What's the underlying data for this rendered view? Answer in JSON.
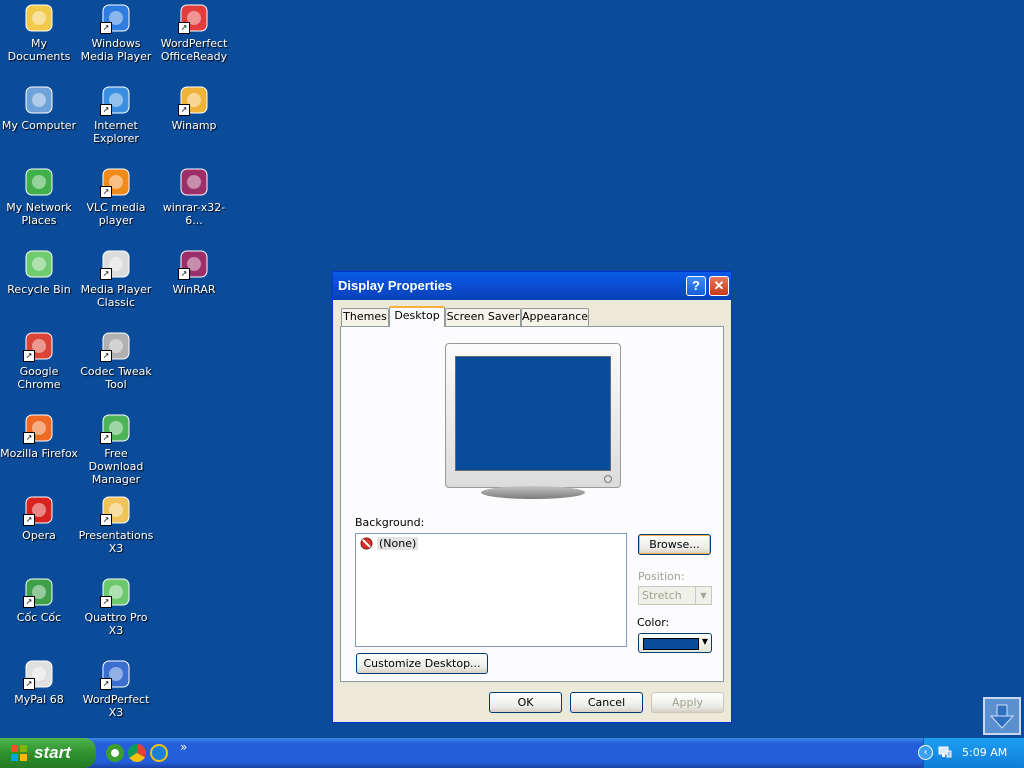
{
  "desktop": {
    "icons": [
      {
        "id": "my-documents",
        "label": "My Documents",
        "icon": "folder-icon",
        "shortcut": false
      },
      {
        "id": "windows-media-player",
        "label": "Windows Media Player",
        "icon": "media-player-icon",
        "shortcut": true
      },
      {
        "id": "wordperfect-officeready",
        "label": "WordPerfect OfficeReady",
        "icon": "officeready-icon",
        "shortcut": true
      },
      {
        "id": "my-computer",
        "label": "My Computer",
        "icon": "computer-icon",
        "shortcut": false
      },
      {
        "id": "internet-explorer",
        "label": "Internet Explorer",
        "icon": "ie-icon",
        "shortcut": true
      },
      {
        "id": "winamp",
        "label": "Winamp",
        "icon": "winamp-icon",
        "shortcut": true
      },
      {
        "id": "my-network-places",
        "label": "My Network Places",
        "icon": "network-icon",
        "shortcut": false
      },
      {
        "id": "vlc",
        "label": "VLC media player",
        "icon": "vlc-icon",
        "shortcut": true
      },
      {
        "id": "winrar-x32",
        "label": "winrar-x32-6...",
        "icon": "winrar-icon",
        "shortcut": false
      },
      {
        "id": "recycle-bin",
        "label": "Recycle Bin",
        "icon": "recycle-bin-icon",
        "shortcut": false
      },
      {
        "id": "mpc",
        "label": "Media Player Classic",
        "icon": "mpc-icon",
        "shortcut": true
      },
      {
        "id": "winrar",
        "label": "WinRAR",
        "icon": "winrar-icon",
        "shortcut": true
      },
      {
        "id": "chrome",
        "label": "Google Chrome",
        "icon": "chrome-icon",
        "shortcut": true
      },
      {
        "id": "codec-tweak",
        "label": "Codec Tweak Tool",
        "icon": "tools-icon",
        "shortcut": true
      },
      {
        "id": "firefox",
        "label": "Mozilla Firefox",
        "icon": "firefox-icon",
        "shortcut": true
      },
      {
        "id": "fdm",
        "label": "Free Download Manager",
        "icon": "download-manager-icon",
        "shortcut": true
      },
      {
        "id": "opera",
        "label": "Opera",
        "icon": "opera-icon",
        "shortcut": true
      },
      {
        "id": "presentations",
        "label": "Presentations X3",
        "icon": "presentations-icon",
        "shortcut": true
      },
      {
        "id": "coccoc",
        "label": "Cốc Cốc",
        "icon": "coccoc-icon",
        "shortcut": true
      },
      {
        "id": "quattro",
        "label": "Quattro Pro X3",
        "icon": "quattro-icon",
        "shortcut": true
      },
      {
        "id": "mypal",
        "label": "MyPal 68",
        "icon": "mypal-icon",
        "shortcut": true
      },
      {
        "id": "wordperfect",
        "label": "WordPerfect X3",
        "icon": "wordperfect-icon",
        "shortcut": true
      }
    ]
  },
  "dialog": {
    "title": "Display Properties",
    "help": "?",
    "close": "✕",
    "tabs": [
      "Themes",
      "Desktop",
      "Screen Saver",
      "Appearance"
    ],
    "active_tab": "Desktop",
    "background_label": "Background:",
    "background_items": [
      "(None)"
    ],
    "browse": "Browse...",
    "position_label": "Position:",
    "position_value": "Stretch",
    "color_label": "Color:",
    "color_value": "#0a4b9a",
    "customize": "Customize Desktop...",
    "ok": "OK",
    "cancel": "Cancel",
    "apply": "Apply"
  },
  "taskbar": {
    "start": "start",
    "more": "»",
    "clock": "5:09 AM"
  }
}
